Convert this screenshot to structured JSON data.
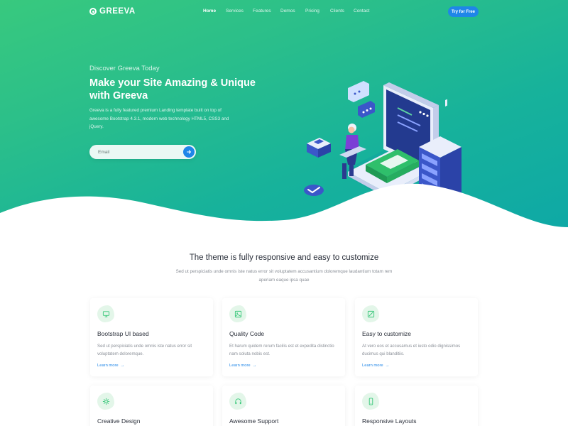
{
  "brand": {
    "name": "GREEVA"
  },
  "nav": {
    "items": [
      "Home",
      "Services",
      "Features",
      "Demos",
      "Pricing",
      "Clients",
      "Contact"
    ],
    "active": "Home",
    "cta_label": "Try for Free"
  },
  "hero": {
    "subtitle": "Discover Greeva Today",
    "title": "Make your Site Amazing & Unique with Greeva",
    "description": "Greeva is a fully featured premium Landing template built on top of awesome Bootstrap 4.3.1, modern web technology HTML5, CSS3 and jQuery.",
    "email_placeholder": "Email",
    "submit_icon": "arrow-right-icon"
  },
  "features": {
    "title": "The theme is fully responsive and easy to customize",
    "description": "Sed ut perspiciatis unde omnis iste natus error sit voluptatem accusantium doloremque laudantium totam rem aperiam eaque ipsa quae",
    "cards": [
      {
        "icon": "monitor-icon",
        "title": "Bootstrap UI based",
        "description": "Sed ut perspiciatis unde omnis iste natus error sit voluptatem doloremque.",
        "link": "Learn more"
      },
      {
        "icon": "image-icon",
        "title": "Quality Code",
        "description": "Et harum quidem rerum facilis est et expedita distinctio nam soluta nobis est.",
        "link": "Learn more"
      },
      {
        "icon": "crop-icon",
        "title": "Easy to customize",
        "description": "At vero eos et accusamus et iusto odio dignissimos ducimus qui blanditiis.",
        "link": "Learn more"
      },
      {
        "icon": "settings-icon",
        "title": "Creative Design",
        "description": "",
        "link": ""
      },
      {
        "icon": "headphones-icon",
        "title": "Awesome Support",
        "description": "",
        "link": ""
      },
      {
        "icon": "smartphone-icon",
        "title": "Responsive Layouts",
        "description": "",
        "link": ""
      }
    ]
  },
  "colors": {
    "accent": "#1f86e8",
    "hero_start": "#38c97e",
    "hero_end": "#0ea8a6",
    "icon_bg": "#e3f6e9",
    "icon_stroke": "#37c779"
  }
}
